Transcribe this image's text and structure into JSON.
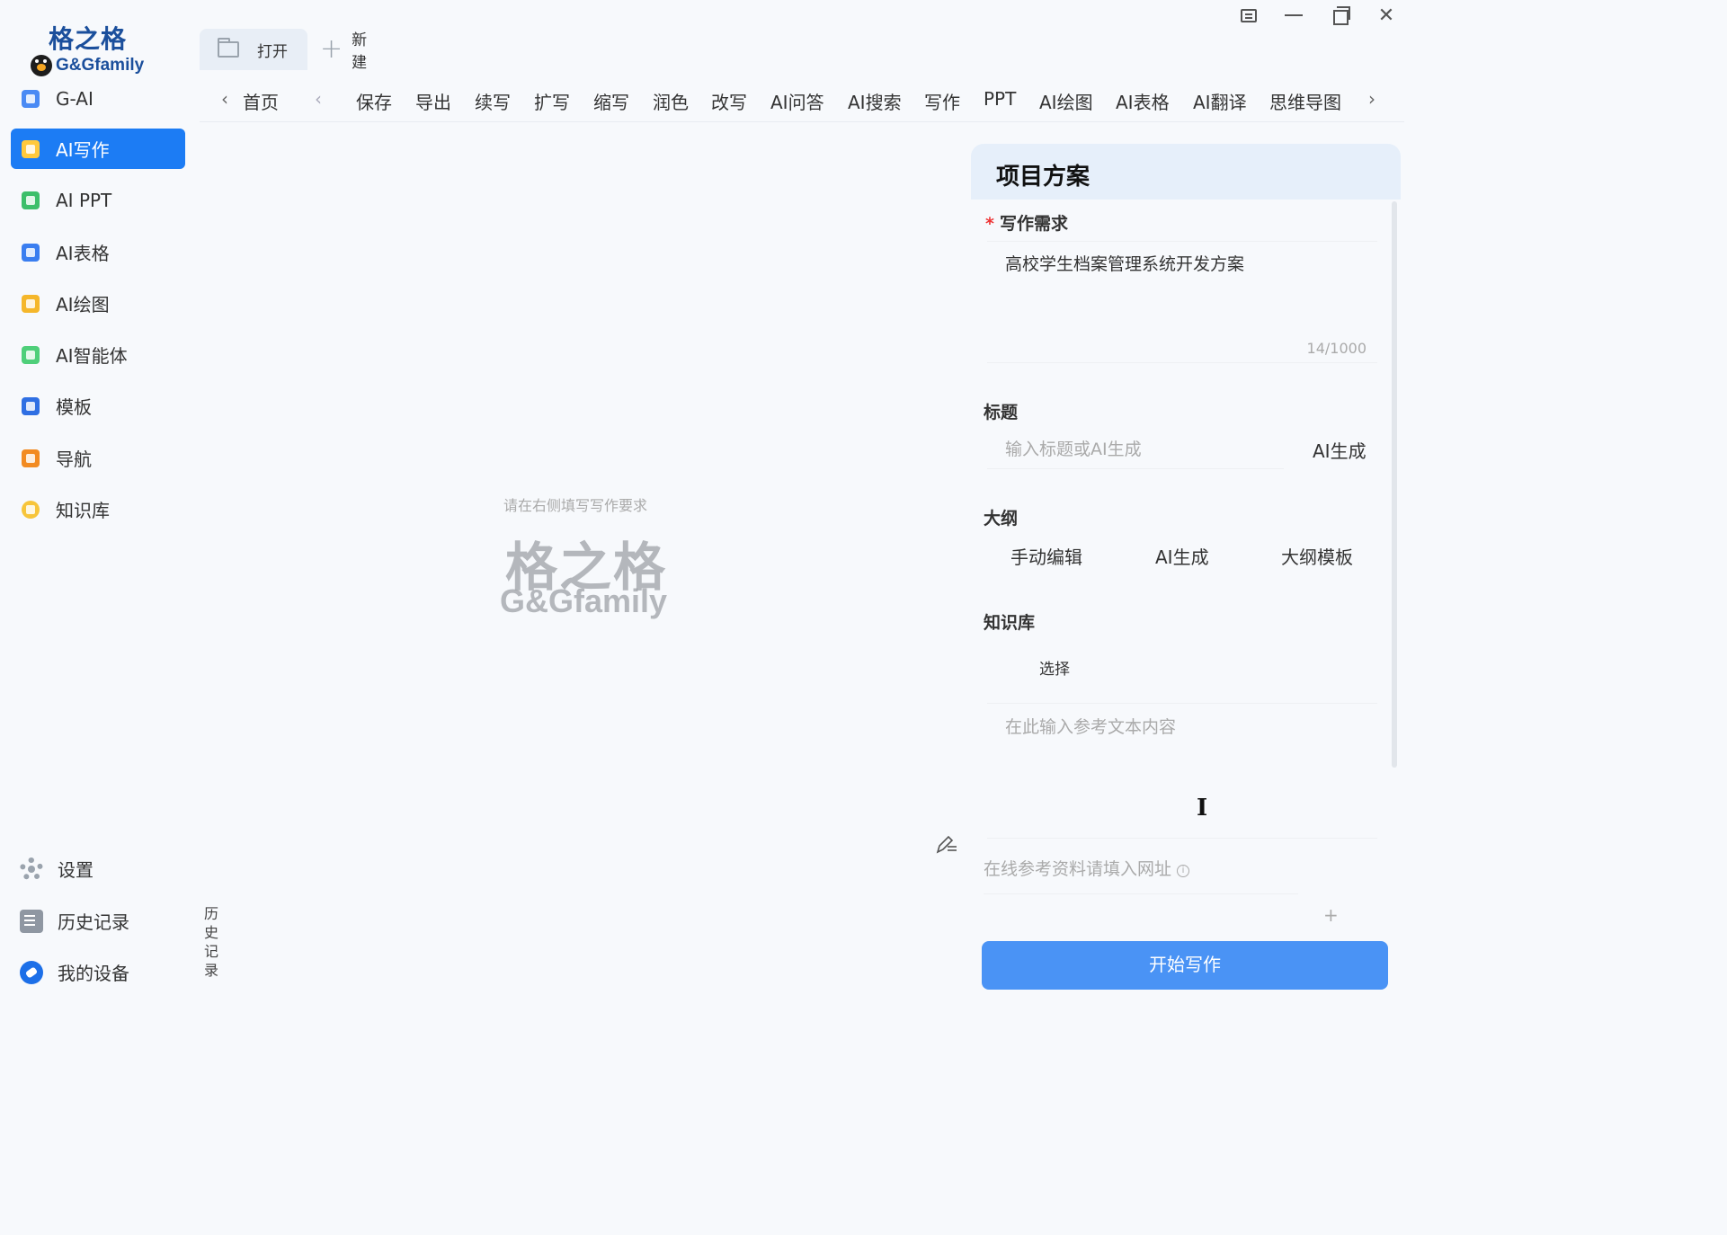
{
  "logo": {
    "cn": "格之格",
    "en": "G&Gfamily"
  },
  "sidebar": {
    "items": [
      {
        "label": "G-AI",
        "color": "#4a8af4",
        "icon": "g-ai-icon"
      },
      {
        "label": "AI写作",
        "color": "#ffc93d",
        "icon": "ai-write-icon",
        "active": true
      },
      {
        "label": "AI PPT",
        "color": "#3cbf6a",
        "icon": "ppt-icon"
      },
      {
        "label": "AI表格",
        "color": "#3a7ef0",
        "icon": "sheet-icon"
      },
      {
        "label": "AI绘图",
        "color": "#f5b72b",
        "icon": "palette-icon"
      },
      {
        "label": "AI智能体",
        "color": "#4fcf7a",
        "icon": "robot-icon"
      },
      {
        "label": "模板",
        "color": "#2f6fe3",
        "icon": "template-icon"
      },
      {
        "label": "导航",
        "color": "#f28b22",
        "icon": "navigation-icon"
      },
      {
        "label": "知识库",
        "color": "#f7c53a",
        "icon": "bulb-icon"
      }
    ],
    "bottom": [
      {
        "label": "设置",
        "icon": "gear-icon"
      },
      {
        "label": "历史记录",
        "icon": "history-icon"
      },
      {
        "label": "我的设备",
        "icon": "device-icon"
      }
    ],
    "vertical_history": [
      "历",
      "史",
      "记",
      "录"
    ]
  },
  "tabs": {
    "open_label": "打开",
    "new_label": "新建"
  },
  "toolbar": {
    "home": "首页",
    "items": [
      "保存",
      "导出",
      "续写",
      "扩写",
      "缩写",
      "润色",
      "改写",
      "AI问答",
      "AI搜索",
      "写作",
      "PPT",
      "AI绘图",
      "AI表格",
      "AI翻译",
      "思维导图"
    ]
  },
  "canvas": {
    "hint": "请在右侧填写写作要求",
    "watermark_cn": "格之格",
    "watermark_en": "G&Gfamily"
  },
  "panel": {
    "title": "项目方案",
    "requirement": {
      "label": "写作需求",
      "required_mark": "*",
      "value": "高校学生档案管理系统开发方案",
      "count": "14/1000"
    },
    "title_section": {
      "label": "标题",
      "placeholder": "输入标题或AI生成",
      "ai_button": "AI生成"
    },
    "outline": {
      "label": "大纲",
      "buttons": [
        "手动编辑",
        "AI生成",
        "大纲模板"
      ]
    },
    "knowledge": {
      "label": "知识库",
      "select": "选择",
      "ref_placeholder": "在此输入参考文本内容"
    },
    "url_placeholder": "在线参考资料请填入网址",
    "url_info": "i",
    "url_add": "+",
    "start_button": "开始写作"
  },
  "colors": {
    "accent": "#1c7cf4",
    "start_button": "#4a93f5",
    "panel_header": "#e6effa"
  }
}
